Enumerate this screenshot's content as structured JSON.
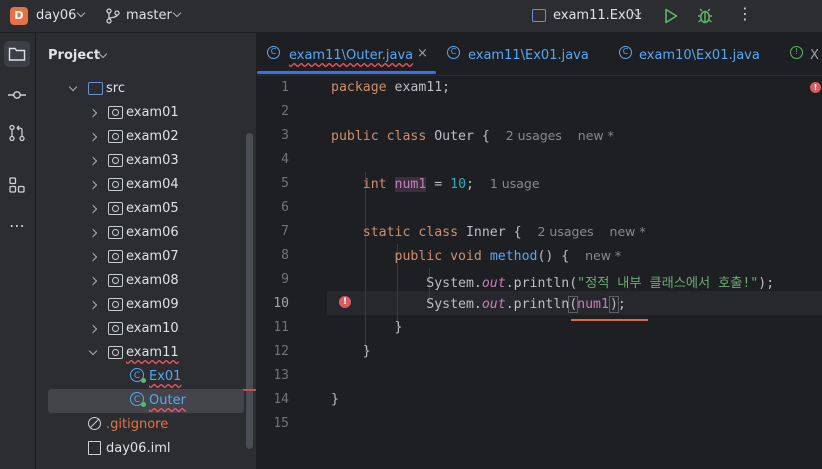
{
  "topbar": {
    "project_badge": "D",
    "project_name": "day06",
    "branch_name": "master",
    "run_config": "exam11.Ex01",
    "icons": [
      "project-chevron-icon",
      "branch-icon",
      "run-config-icon",
      "run-icon",
      "debug-icon",
      "more-icon"
    ]
  },
  "toolstrip": {
    "icons": [
      "project-view-icon",
      "commit-icon",
      "pull-requests-icon",
      "structure-icon",
      "more-tools-icon"
    ]
  },
  "project_panel": {
    "title": "Project",
    "tree": [
      {
        "label": "src",
        "indent": 1,
        "expanded": true,
        "type": "source-folder"
      },
      {
        "label": "exam01",
        "indent": 2,
        "expanded": false,
        "type": "package"
      },
      {
        "label": "exam02",
        "indent": 2,
        "expanded": false,
        "type": "package"
      },
      {
        "label": "exam03",
        "indent": 2,
        "expanded": false,
        "type": "package"
      },
      {
        "label": "exam04",
        "indent": 2,
        "expanded": false,
        "type": "package"
      },
      {
        "label": "exam05",
        "indent": 2,
        "expanded": false,
        "type": "package"
      },
      {
        "label": "exam06",
        "indent": 2,
        "expanded": false,
        "type": "package"
      },
      {
        "label": "exam07",
        "indent": 2,
        "expanded": false,
        "type": "package"
      },
      {
        "label": "exam08",
        "indent": 2,
        "expanded": false,
        "type": "package"
      },
      {
        "label": "exam09",
        "indent": 2,
        "expanded": false,
        "type": "package"
      },
      {
        "label": "exam10",
        "indent": 2,
        "expanded": false,
        "type": "package"
      },
      {
        "label": "exam11",
        "indent": 2,
        "expanded": true,
        "type": "package"
      },
      {
        "label": "Ex01",
        "indent": 3,
        "type": "class"
      },
      {
        "label": "Outer",
        "indent": 3,
        "type": "class",
        "selected": true
      },
      {
        "label": ".gitignore",
        "indent": 1,
        "type": "ignore-file"
      },
      {
        "label": "day06.iml",
        "indent": 1,
        "type": "module-file"
      }
    ]
  },
  "tabs": [
    {
      "label": "exam11\\Outer.java",
      "active": true
    },
    {
      "label": "exam11\\Ex01.java",
      "active": false
    },
    {
      "label": "exam10\\Ex01.java",
      "active": false
    },
    {
      "label": "X",
      "active": false
    }
  ],
  "editor": {
    "current_line": 10,
    "line_numbers": [
      "1",
      "2",
      "3",
      "4",
      "5",
      "6",
      "7",
      "8",
      "9",
      "10",
      "11",
      "12",
      "13",
      "14",
      "15"
    ],
    "code": {
      "l1_kw": "package",
      "l1_rest": " exam11;",
      "l3_kw": "public class",
      "l3_cls": " Outer {",
      "l3_hint1": "2 usages",
      "l3_hint2": "new *",
      "l5_kw": "int",
      "l5_fld": "num1",
      "l5_eq": " = ",
      "l5_num": "10",
      "l5_semi": ";",
      "l5_hint": "1 usage",
      "l7_kw": "static class",
      "l7_cls": " Inner {",
      "l7_hint1": "2 usages",
      "l7_hint2": "new *",
      "l8_kw": "public void",
      "l8_fn": "method",
      "l8_rest": "() {",
      "l8_hint": "new *",
      "l9_obj": "System.",
      "l9_out": "out",
      "l9_call": ".println(",
      "l9_str": "\"정적 내부 클래스에서 호출!\"",
      "l9_end": ");",
      "l10_obj": "System.",
      "l10_out": "out",
      "l10_call": ".println",
      "l10_paren": "(",
      "l10_fld": "num1",
      "l10_close": ")",
      "l10_end": ";",
      "l11": "}",
      "l12": "}",
      "l14": "}"
    }
  },
  "colors": {
    "background": "#1e1f22",
    "panel": "#2b2d30",
    "accent": "#3574f0",
    "keyword": "#cf8e6d",
    "field": "#c77dbb",
    "string": "#6aab73",
    "number": "#2aacb8",
    "error": "#db5c5c"
  }
}
